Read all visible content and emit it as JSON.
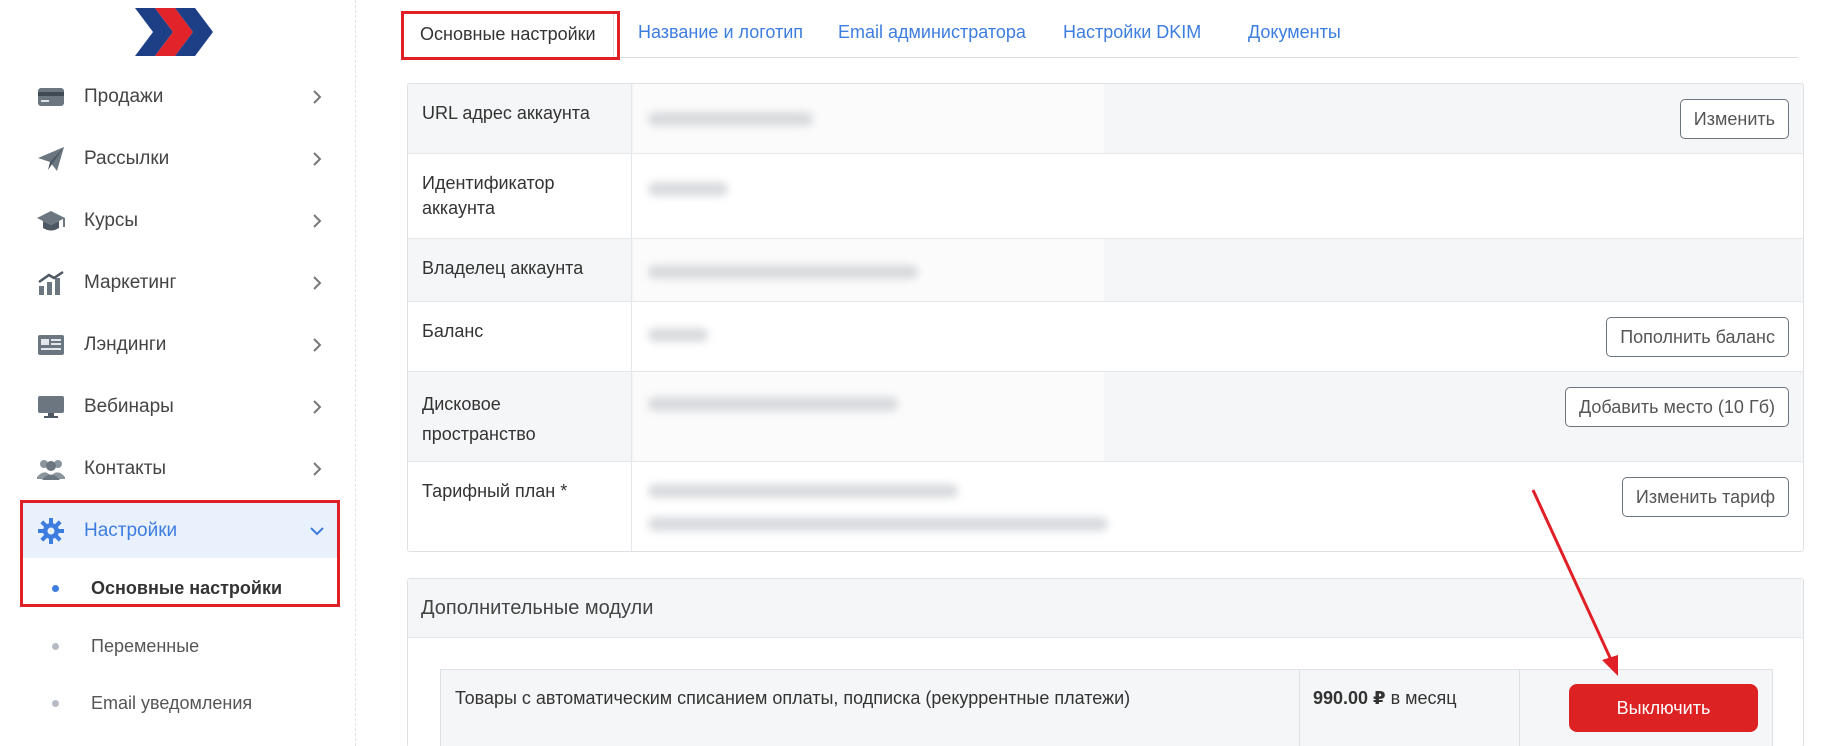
{
  "sidebar": {
    "items": [
      {
        "label": "Продажи",
        "icon": "card-icon"
      },
      {
        "label": "Рассылки",
        "icon": "paper-plane-icon"
      },
      {
        "label": "Курсы",
        "icon": "graduation-cap-icon"
      },
      {
        "label": "Маркетинг",
        "icon": "chart-growth-icon"
      },
      {
        "label": "Лэндинги",
        "icon": "landing-page-icon"
      },
      {
        "label": "Вебинары",
        "icon": "monitor-icon"
      },
      {
        "label": "Контакты",
        "icon": "users-icon"
      },
      {
        "label": "Настройки",
        "icon": "gear-icon"
      }
    ],
    "sub_items": [
      {
        "label": "Основные настройки"
      },
      {
        "label": "Переменные"
      },
      {
        "label": "Email уведомления"
      }
    ]
  },
  "tabs": [
    {
      "label": "Основные настройки"
    },
    {
      "label": "Название и логотип"
    },
    {
      "label": "Email администратора"
    },
    {
      "label": "Настройки DKIM"
    },
    {
      "label": "Документы"
    }
  ],
  "account": {
    "rows": [
      {
        "label": "URL адрес аккаунта",
        "button": "Изменить"
      },
      {
        "label": "Идентификатор аккаунта"
      },
      {
        "label": "Владелец аккаунта"
      },
      {
        "label": "Баланс",
        "button": "Пополнить баланс"
      },
      {
        "label": "Дисковое пространство",
        "button": "Добавить место (10 Гб)"
      },
      {
        "label": "Тарифный план *",
        "button": "Изменить тариф"
      }
    ]
  },
  "modules": {
    "title": "Дополнительные модули",
    "item": {
      "name": "Товары с автоматическим списанием оплаты, подписка (рекуррентные платежи)",
      "price": "990.00 ₽",
      "period": "в месяц",
      "button": "Выключить"
    }
  },
  "colors": {
    "accent": "#3d7de0",
    "highlight": "#e11f26",
    "danger": "#dc2222"
  }
}
